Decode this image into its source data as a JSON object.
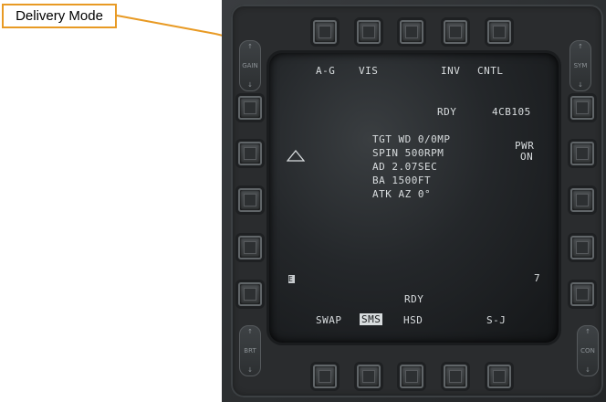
{
  "annotation": {
    "label": "Delivery Mode"
  },
  "mfd": {
    "top_row": {
      "left": "A-G",
      "mode": "VIS",
      "inv": "INV",
      "cntl": "CNTL"
    },
    "status": {
      "ready": "RDY",
      "station": "4CB105"
    },
    "pwr": {
      "line1": "PWR",
      "line2": "ON"
    },
    "params": {
      "l1": "TGT WD 0/0MP",
      "l2": "SPIN 500RPM",
      "l3": "AD 2.07SEC",
      "l4": "BA 1500FT",
      "l5": "ATK AZ 0°"
    },
    "left_marker": "E",
    "right_marker": "7",
    "bottom_ready": "RDY",
    "bottom_row": {
      "swap": "SWAP",
      "sms": "SMS",
      "hsd": "HSD",
      "sj": "S-J"
    },
    "rockers": {
      "gain": "GAIN",
      "sym": "SYM",
      "brt": "BRT",
      "con": "CON",
      "up": "↑",
      "down": "↓"
    }
  }
}
